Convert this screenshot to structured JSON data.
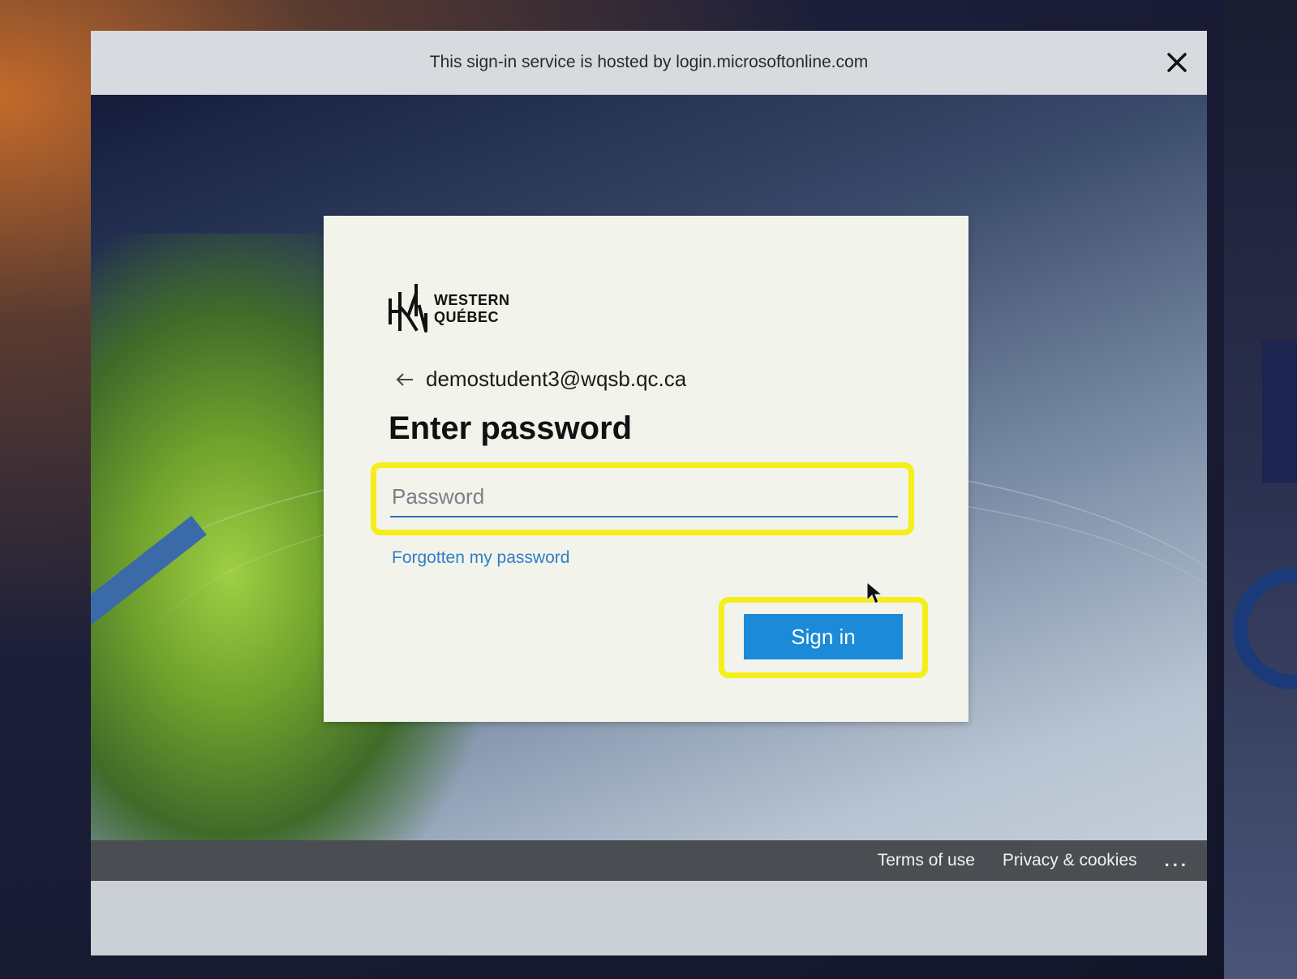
{
  "header": {
    "notice": "This sign-in service is hosted by login.microsoftonline.com",
    "close_icon": "close-icon"
  },
  "card": {
    "logo": {
      "line1": "WESTERN",
      "line2": "QUÉBEC",
      "icon": "western-quebec-logo"
    },
    "identity": {
      "back_icon": "back-arrow-icon",
      "email": "demostudent3@wqsb.qc.ca"
    },
    "title": "Enter password",
    "password": {
      "placeholder": "Password",
      "value": ""
    },
    "forgot_link": "Forgotten my password",
    "signin_button": "Sign in"
  },
  "footer": {
    "terms": "Terms of use",
    "privacy": "Privacy & cookies",
    "more": "..."
  },
  "colors": {
    "highlight": "#f4ee1a",
    "primary_button": "#1a8ad9",
    "link": "#2f7fc9",
    "footer_bg": "#4a4d52"
  }
}
